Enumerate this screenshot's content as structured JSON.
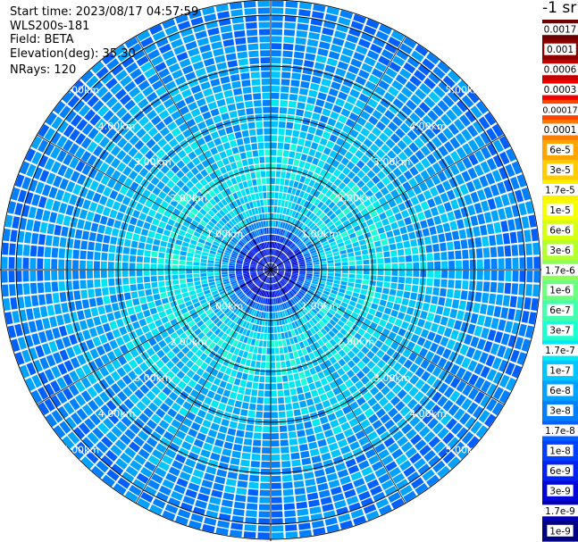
{
  "header": {
    "start_time": "Start time: 2023/08/17 04:57:59",
    "instrument": "WLS200s-181",
    "field": "Field: BETA",
    "elevation": "Elevation(deg): 35.30",
    "nrays": "NRays: 120",
    "unit": "-1 sr"
  },
  "chart_data": {
    "type": "polar-ppi",
    "field": "BETA",
    "n_rays": 120,
    "range_rings_km": [
      1,
      2,
      3,
      4,
      5
    ],
    "range_ring_labels": [
      "1.00km",
      "2.00km",
      "3.00km",
      "4.00km",
      "5.00km"
    ],
    "max_range_km": 5.3,
    "spoke_angles_deg": [
      0,
      30,
      60,
      90,
      120,
      150,
      180,
      210,
      240,
      270,
      300,
      330
    ],
    "radial_profile": [
      {
        "range_km": 0.0,
        "beta": 6e-09
      },
      {
        "range_km": 0.5,
        "beta": 4e-09
      },
      {
        "range_km": 1.0,
        "beta": 9e-08
      },
      {
        "range_km": 1.5,
        "beta": 1.2e-07
      },
      {
        "range_km": 2.0,
        "beta": 1.5e-07
      },
      {
        "range_km": 2.5,
        "beta": 1e-07
      },
      {
        "range_km": 3.0,
        "beta": 8e-08
      },
      {
        "range_km": 3.5,
        "beta": 6e-08
      },
      {
        "range_km": 4.0,
        "beta": 5e-08
      },
      {
        "range_km": 4.5,
        "beta": 4e-08
      },
      {
        "range_km": 5.0,
        "beta": 3e-08
      },
      {
        "range_km": 5.3,
        "beta": 3e-08
      }
    ],
    "colorbar": {
      "labels": [
        "0.0017",
        "0.001",
        "0.0006",
        "0.0003",
        "0.00017",
        "0.0001",
        "6e-5",
        "3e-5",
        "1.7e-5",
        "1e-5",
        "6e-6",
        "3e-6",
        "1.7e-6",
        "1e-6",
        "6e-7",
        "3e-7",
        "1.7e-7",
        "1e-7",
        "6e-8",
        "3e-8",
        "1.7e-8",
        "1e-8",
        "6e-9",
        "3e-9",
        "1.7e-9",
        "1e-9"
      ],
      "colors": [
        "#6a0000",
        "#8e0000",
        "#c40000",
        "#f20000",
        "#ff4400",
        "#ff7a00",
        "#ffa500",
        "#ffcc00",
        "#fff000",
        "#f5ff00",
        "#d6ff12",
        "#b4ff2e",
        "#8eff5a",
        "#6cff80",
        "#46ffae",
        "#1effd2",
        "#00e8f0",
        "#00c6ff",
        "#00a2ff",
        "#0080ff",
        "#0060ff",
        "#0040ff",
        "#0022f0",
        "#0008d8",
        "#0000b0",
        "#000085"
      ]
    }
  }
}
